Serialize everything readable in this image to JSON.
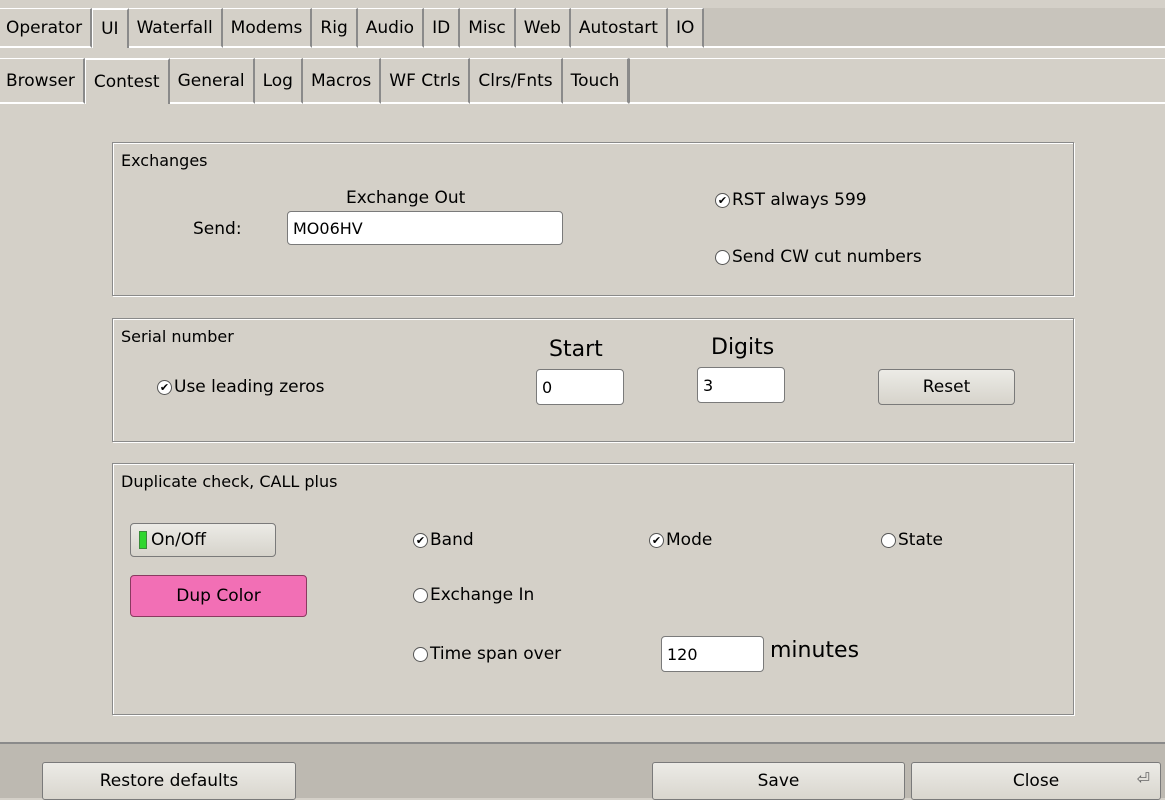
{
  "tabs_top": [
    "Operator",
    "UI",
    "Waterfall",
    "Modems",
    "Rig",
    "Audio",
    "ID",
    "Misc",
    "Web",
    "Autostart",
    "IO"
  ],
  "tabs_sub": [
    "Browser",
    "Contest",
    "General",
    "Log",
    "Macros",
    "WF Ctrls",
    "Clrs/Fnts",
    "Touch"
  ],
  "exchanges": {
    "title": "Exchanges",
    "exchange_out_label": "Exchange Out",
    "send_label": "Send:",
    "send_value": "MO06HV",
    "rst_label": "RST always 599",
    "rst_checked": true,
    "cut_label": "Send CW cut numbers",
    "cut_checked": false
  },
  "serial": {
    "title": "Serial number",
    "leading_label": "Use leading zeros",
    "leading_checked": true,
    "start_label": "Start",
    "start_value": "0",
    "digits_label": "Digits",
    "digits_value": "3",
    "reset_label": "Reset"
  },
  "dup": {
    "title": "Duplicate check, CALL plus",
    "onoff_label": "On/Off",
    "dupcolor_label": "Dup Color",
    "dupcolor_color": "#f26fb5",
    "band_label": "Band",
    "band_checked": true,
    "mode_label": "Mode",
    "mode_checked": true,
    "state_label": "State",
    "state_checked": false,
    "exchange_in_label": "Exchange In",
    "exchange_in_checked": false,
    "timespan_label": "Time span over",
    "timespan_checked": false,
    "timespan_value": "120",
    "minutes_label": "minutes"
  },
  "footer": {
    "restore_label": "Restore defaults",
    "save_label": "Save",
    "close_label": "Close"
  }
}
